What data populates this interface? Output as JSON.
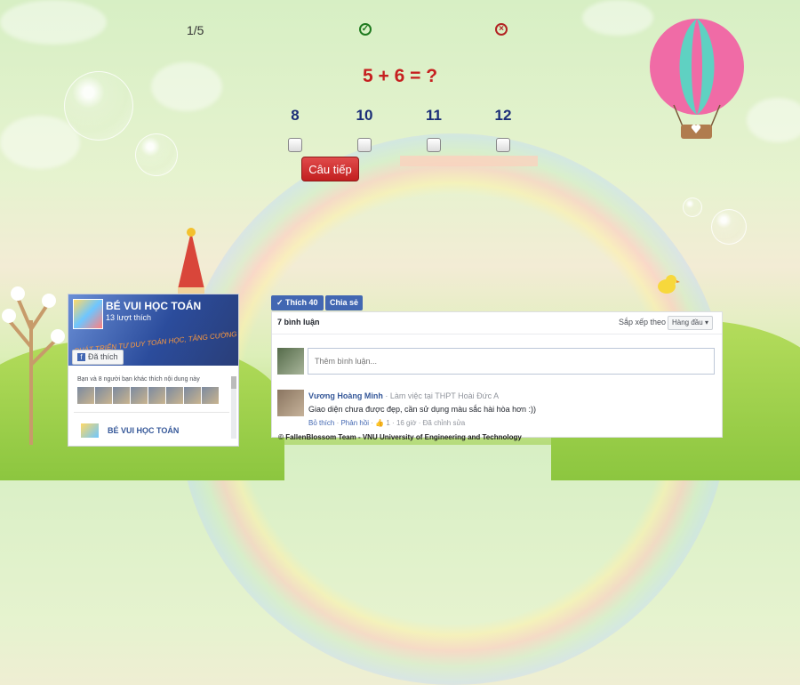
{
  "quiz": {
    "progress": "1/5",
    "question": "5 + 6 = ?",
    "answers": [
      "8",
      "10",
      "11",
      "12"
    ],
    "next_label": "Câu tiếp",
    "correct_icon": "check-circle-icon",
    "wrong_icon": "x-circle-icon"
  },
  "fb_page": {
    "name": "BÉ VUI HỌC TOÁN",
    "likes": "13 lượt thích",
    "slogan": "PHÁT TRIỂN TƯ DUY TOÁN HỌC, TĂNG CƯỜNG TRÍ THÔNG MINH",
    "liked_label": "Đã thích",
    "friends_text": "Bạn và 8 người bạn khác thích nội dung này",
    "bottom_name": "BÉ VUI HỌC TOÁN"
  },
  "fb_actions": {
    "like_label": "Thích 40",
    "share_label": "Chia sẻ"
  },
  "comments": {
    "count": "7 bình luận",
    "sort_label": "Sắp xếp theo",
    "sort_value": "Hàng đầu",
    "placeholder": "Thêm bình luận...",
    "items": [
      {
        "author": "Vương Hoàng Minh",
        "meta": " · Làm việc tại THPT Hoài Đức A",
        "text": "Giao diện chưa được đẹp, cần sử dụng màu sắc hài hòa hơn :))",
        "like": "Bỏ thích",
        "reply": "Phản hồi",
        "reactions": "1",
        "time": "16 giờ",
        "edited": "Đã chỉnh sửa"
      }
    ]
  },
  "footer": "© FallenBlossom Team - VNU University of Engineering and Technology",
  "colors": {
    "question": "#c62020",
    "answers": "#1b2e78",
    "next_button": "#c21f1f",
    "facebook_blue": "#4267b2"
  }
}
